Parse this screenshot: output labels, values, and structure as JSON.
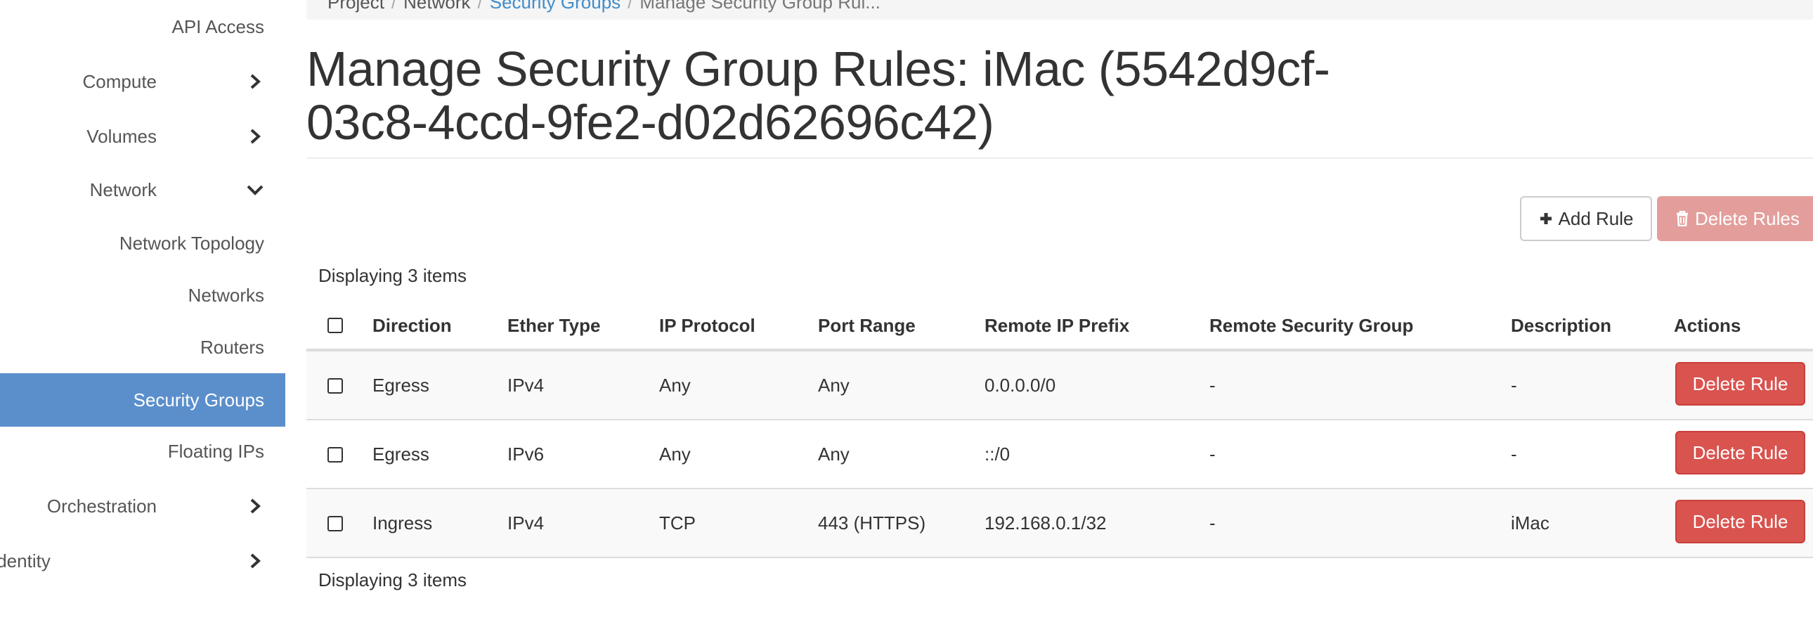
{
  "sidebar": {
    "items": [
      {
        "label": "API Access"
      },
      {
        "label": "Compute"
      },
      {
        "label": "Volumes"
      },
      {
        "label": "Network"
      },
      {
        "label": "Network Topology"
      },
      {
        "label": "Networks"
      },
      {
        "label": "Routers"
      },
      {
        "label": "Security Groups"
      },
      {
        "label": "Floating IPs"
      },
      {
        "label": "Orchestration"
      },
      {
        "label": "Identity"
      }
    ]
  },
  "breadcrumb": {
    "items": [
      "Project",
      "Network",
      "Security Groups",
      "Manage Security Group Rul..."
    ],
    "separator": "/"
  },
  "page": {
    "title": "Manage Security Group Rules: iMac (5542d9cf-03c8-4ccd-9fe2-d02d62696c42)"
  },
  "toolbar": {
    "add_label": "Add Rule",
    "delete_label": "Delete Rules"
  },
  "table": {
    "count_top": "Displaying 3 items",
    "count_bottom": "Displaying 3 items",
    "columns": [
      "Direction",
      "Ether Type",
      "IP Protocol",
      "Port Range",
      "Remote IP Prefix",
      "Remote Security Group",
      "Description",
      "Actions"
    ],
    "rows": [
      {
        "direction": "Egress",
        "ether_type": "IPv4",
        "ip_protocol": "Any",
        "port_range": "Any",
        "remote_ip_prefix": "0.0.0.0/0",
        "remote_security_group": "-",
        "description": "-",
        "action": "Delete Rule"
      },
      {
        "direction": "Egress",
        "ether_type": "IPv6",
        "ip_protocol": "Any",
        "port_range": "Any",
        "remote_ip_prefix": "::/0",
        "remote_security_group": "-",
        "description": "-",
        "action": "Delete Rule"
      },
      {
        "direction": "Ingress",
        "ether_type": "IPv4",
        "ip_protocol": "TCP",
        "port_range": "443 (HTTPS)",
        "remote_ip_prefix": "192.168.0.1/32",
        "remote_security_group": "-",
        "description": "iMac",
        "action": "Delete Rule"
      }
    ]
  },
  "icons": {
    "chevron_right": "chevron-right-icon",
    "chevron_down": "chevron-down-icon",
    "plus": "plus-icon",
    "trash": "trash-icon"
  },
  "colors": {
    "active_nav": "#5b8fcc",
    "link": "#428bca",
    "danger": "#d9534f",
    "danger_disabled": "#e39e9c"
  }
}
